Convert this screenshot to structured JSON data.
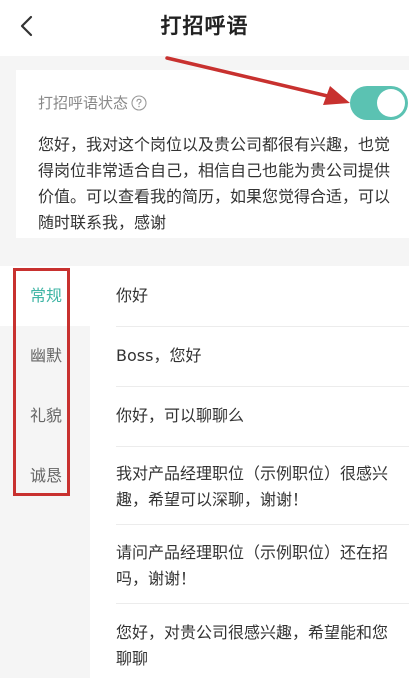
{
  "header": {
    "title": "打招呼语"
  },
  "status": {
    "label": "打招呼语状态",
    "toggle_on": true,
    "text": "您好，我对这个岗位以及贵公司都很有兴趣，也觉得岗位非常适合自己，相信自己也能为贵公司提供价值。可以查看我的简历，如果您觉得合适，可以随时联系我，感谢"
  },
  "categories": [
    "常规",
    "幽默",
    "礼貌",
    "诚恳"
  ],
  "active_category": "常规",
  "messages": [
    "你好",
    "Boss，您好",
    "你好，可以聊聊么",
    "我对产品经理职位（示例职位）很感兴趣，希望可以深聊，谢谢！",
    "请问产品经理职位（示例职位）还在招吗，谢谢！",
    "您好，对贵公司很感兴趣，希望能和您聊聊"
  ],
  "colors": {
    "accent": "#5bc2b2",
    "active_text": "#3fb5a5",
    "annotation": "#c8312f"
  },
  "icons": {
    "back": "chevron-left-icon",
    "help": "question-circle-icon"
  }
}
